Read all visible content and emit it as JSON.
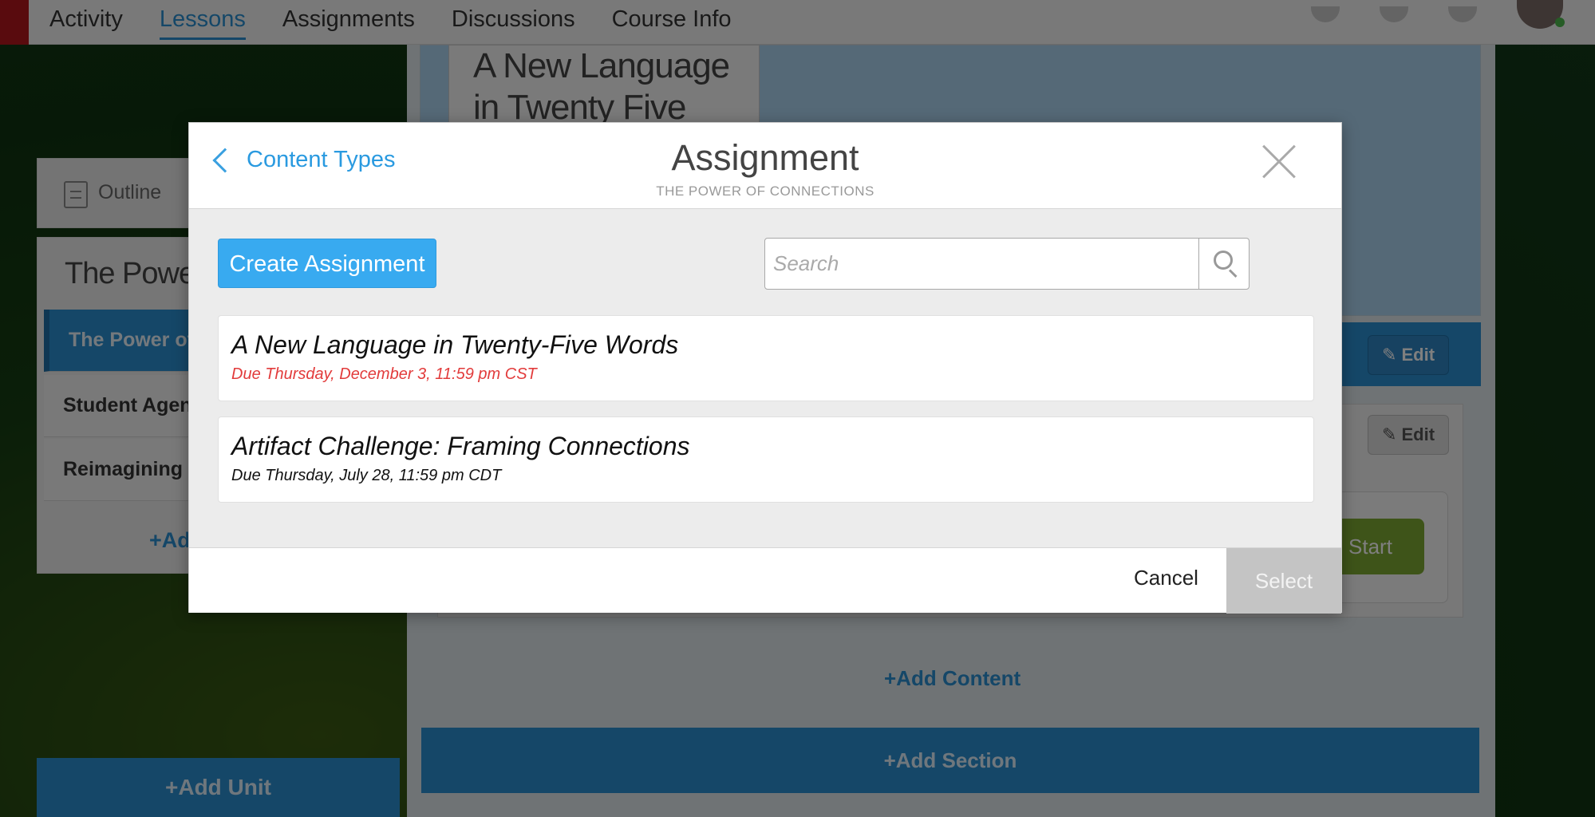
{
  "nav": {
    "title": "",
    "items": [
      {
        "label": "Activity",
        "active": false
      },
      {
        "label": "Lessons",
        "active": true
      },
      {
        "label": "Assignments",
        "active": false
      },
      {
        "label": "Discussions",
        "active": false
      },
      {
        "label": "Course Info",
        "active": false
      }
    ]
  },
  "left": {
    "outline_label": "Outline",
    "unit_title": "The Power of Connections",
    "lessons": [
      {
        "label": "The Power of Connections",
        "active": true
      },
      {
        "label": "Student Agency",
        "active": false
      },
      {
        "label": "Reimagining the Classroom",
        "active": false
      }
    ],
    "add_lesson_label": "+Add Lesson",
    "add_unit_label": "+Add Unit"
  },
  "background": {
    "card_title": "A New Language in Twenty Five Words",
    "edit_label": "Edit",
    "start_label": "Start",
    "add_content_label": "+Add Content",
    "add_section_label": "+Add Section"
  },
  "modal": {
    "back_label": "Content Types",
    "title": "Assignment",
    "subtitle": "THE POWER OF CONNECTIONS",
    "create_label": "Create Assignment",
    "search": {
      "placeholder": "Search",
      "value": ""
    },
    "items": [
      {
        "title": "A New Language in Twenty-Five Words",
        "due": "Due Thursday, December 3, 11:59 pm CST",
        "overdue": true
      },
      {
        "title": "Artifact Challenge: Framing Connections",
        "due": "Due Thursday, July 28, 11:59 pm CDT",
        "overdue": false
      }
    ],
    "cancel_label": "Cancel",
    "select_label": "Select"
  },
  "colors": {
    "accent": "#2a8fd0",
    "primary_button": "#38aaf0",
    "overdue": "#e23b3b",
    "start_button": "#7da832",
    "disabled": "#c4c4c4"
  }
}
